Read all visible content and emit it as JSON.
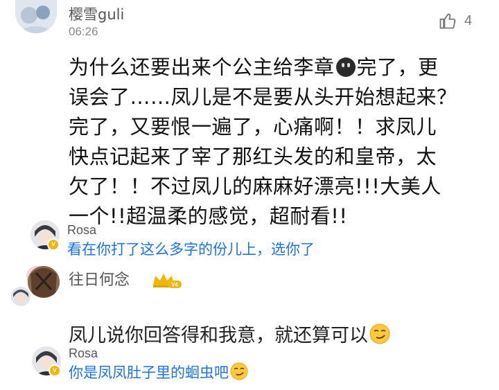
{
  "comment": {
    "username": "樱雪guli",
    "time": "06:26",
    "likes": "4",
    "text_lines": [
      [
        "为什么还要出来个公主给李章",
        "{dark-emoji}",
        "完了，更"
      ],
      [
        "误会了……凤儿是不是要从头开始想起来？"
      ],
      [
        "完了，又要恨一遍了，心痛啊！！求凤儿"
      ],
      [
        "快点记起来了宰了那红头发的和皇帝，太"
      ],
      [
        "欠了！！不过凤儿的麻麻好漂亮!!!大美人"
      ],
      [
        "一个!!超温柔的感觉，超耐看!!"
      ]
    ],
    "line_1a": "为什么还要出来个公主给李章",
    "line_1b": "完了，更",
    "line_2": "误会了……凤儿是不是要从头开始想起来？",
    "line_3": "完了，又要恨一遍了，心痛啊！！求凤儿",
    "line_4": "快点记起来了宰了那红头发的和皇帝，太",
    "line_5": "欠了！！不过凤儿的麻麻好漂亮!!!大美人",
    "line_6": "一个!!超温柔的感觉，超耐看!!"
  },
  "replies": [
    {
      "username": "Rosa",
      "text": "看在你打了这么多字的份儿上，选你了",
      "vip_badge": "v"
    },
    {
      "username": "往日何念",
      "level_badge": "V4",
      "text": "凤儿说你回答得和我意，就还算可以"
    },
    {
      "username": "Rosa",
      "text": "你是凤凤肚子里的蛔虫吧",
      "vip_badge": "v"
    }
  ],
  "icons": {
    "like": "thumbs-up-icon",
    "dark_emoji": "dark-face-emoji-icon",
    "smirk_emoji": "smirk-face-emoji-icon",
    "crown": "crown-icon"
  },
  "colors": {
    "reply_blue": "#1a73e8",
    "gold": "#f2b705",
    "muted": "#888888"
  }
}
